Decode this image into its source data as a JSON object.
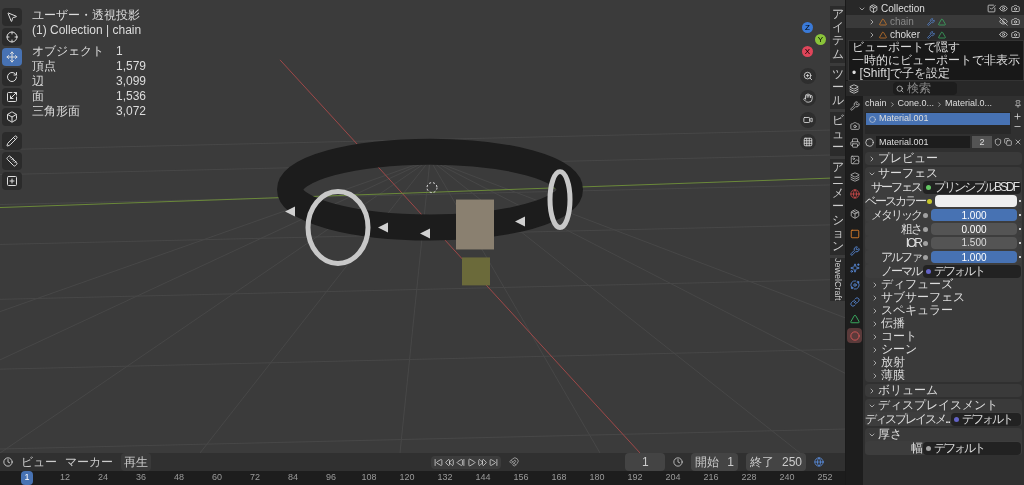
{
  "viewport": {
    "view_name": "ユーザー・透視投影",
    "context": "(1) Collection | chain",
    "stats": [
      {
        "label": "オブジェクト",
        "value": "1"
      },
      {
        "label": "頂点",
        "value": "1,579"
      },
      {
        "label": "辺",
        "value": "3,099"
      },
      {
        "label": "面",
        "value": "1,536"
      },
      {
        "label": "三角形面",
        "value": "3,072"
      }
    ],
    "tools": [
      {
        "kind": "select",
        "selected": false
      },
      {
        "kind": "cursor",
        "selected": false
      },
      {
        "kind": "move",
        "selected": true
      },
      {
        "kind": "rotate",
        "selected": false
      },
      {
        "kind": "scale",
        "selected": false
      },
      {
        "kind": "transform",
        "selected": false
      },
      {
        "kind": "annotate",
        "selected": false
      },
      {
        "kind": "measure",
        "selected": false
      },
      {
        "kind": "add",
        "selected": false
      }
    ],
    "gizmo": {
      "x": "X",
      "y": "Y",
      "z": "Z"
    },
    "sidebar_tabs": [
      {
        "label": "アイテム",
        "kind": "cjk"
      },
      {
        "label": "ツール",
        "kind": "cjk"
      },
      {
        "label": "ビュー",
        "kind": "cjk"
      },
      {
        "label": "アニメーション",
        "kind": "cjk"
      },
      {
        "label": "JewelCraft",
        "kind": "latin"
      }
    ]
  },
  "outliner": {
    "collection": {
      "label": "Collection",
      "checked": true
    },
    "objects": [
      {
        "label": "chain",
        "selected": true,
        "hidden": true
      },
      {
        "label": "choker",
        "selected": false,
        "hidden": false
      }
    ],
    "tooltip": {
      "title": "ビューポートで隠す",
      "description": "一時的にビューポートで非表示",
      "hint": "• [Shift]で子を設定"
    }
  },
  "properties": {
    "search": {
      "placeholder": "検索"
    },
    "tabs": [
      {
        "kind": "tool",
        "selected": false
      },
      {
        "kind": "render",
        "selected": false
      },
      {
        "kind": "output",
        "selected": false
      },
      {
        "kind": "view_layer",
        "selected": false
      },
      {
        "kind": "scene",
        "selected": false
      },
      {
        "kind": "world",
        "selected": false
      },
      {
        "kind": "collection",
        "selected": false
      },
      {
        "kind": "object",
        "selected": false
      },
      {
        "kind": "modifier",
        "selected": false
      },
      {
        "kind": "particles",
        "selected": false
      },
      {
        "kind": "physics",
        "selected": false
      },
      {
        "kind": "constraints",
        "selected": false
      },
      {
        "kind": "data",
        "selected": false
      },
      {
        "kind": "material",
        "selected": true
      }
    ],
    "breadcrumb": [
      "chain",
      "Cone.0...",
      "Material.0..."
    ],
    "slots": [
      {
        "label": "Material.001",
        "selected": true
      }
    ],
    "material": {
      "name": "Material.001",
      "users": "2"
    },
    "panels": [
      {
        "title": "プレビュー",
        "expanded": false
      },
      {
        "title": "サーフェス",
        "expanded": true,
        "rows": [
          {
            "kind": "shader",
            "label": "サーフェス",
            "value": "プリンシプルBSDF",
            "color": "#63c763"
          },
          {
            "kind": "color",
            "label": "ベースカラー",
            "color": "#c7c729"
          },
          {
            "kind": "slider",
            "label": "メタリック",
            "value": "1.000",
            "level": 1,
            "color": "#a1a1a1"
          },
          {
            "kind": "slider",
            "label": "粗さ",
            "value": "0.000",
            "level": 0,
            "color": "#a1a1a1"
          },
          {
            "kind": "number",
            "label": "IOR",
            "value": "1.500",
            "color": "#a1a1a1"
          },
          {
            "kind": "slider",
            "label": "アルファ",
            "value": "1.000",
            "level": 1,
            "color": "#a1a1a1"
          },
          {
            "kind": "shader",
            "label": "ノーマル",
            "value": "デフォルト",
            "color": "#6363c7"
          }
        ],
        "subpanels": [
          "ディフューズ",
          "サブサーフェス",
          "スペキュラー",
          "伝播",
          "コート",
          "シーン",
          "放射",
          "薄膜"
        ]
      },
      {
        "title": "ボリューム",
        "expanded": false
      },
      {
        "title": "ディスプレイスメント",
        "expanded": true,
        "rows": [
          {
            "kind": "shader",
            "label": "ディスプレイスメ...",
            "value": "デフォルト",
            "color": "#6363c7"
          }
        ]
      },
      {
        "title": "厚さ",
        "expanded": true,
        "rows": [
          {
            "kind": "shader",
            "label": "幅",
            "value": "デフォルト",
            "color": "#a1a1a1"
          }
        ]
      }
    ]
  },
  "timeline": {
    "menus": [
      "ビュー",
      "マーカー"
    ],
    "playback": "再生",
    "current_frame": "1",
    "start_label": "開始",
    "start": "1",
    "end_label": "終了",
    "end": "250",
    "ticks": [
      {
        "label": "1",
        "selected": true
      },
      {
        "label": "12",
        "selected": false
      },
      {
        "label": "24",
        "selected": false
      },
      {
        "label": "36",
        "selected": false
      },
      {
        "label": "48",
        "selected": false
      },
      {
        "label": "60",
        "selected": false
      },
      {
        "label": "72",
        "selected": false
      },
      {
        "label": "84",
        "selected": false
      },
      {
        "label": "96",
        "selected": false
      },
      {
        "label": "108",
        "selected": false
      },
      {
        "label": "120",
        "selected": false
      },
      {
        "label": "132",
        "selected": false
      },
      {
        "label": "144",
        "selected": false
      },
      {
        "label": "156",
        "selected": false
      },
      {
        "label": "168",
        "selected": false
      },
      {
        "label": "180",
        "selected": false
      },
      {
        "label": "192",
        "selected": false
      },
      {
        "label": "204",
        "selected": false
      },
      {
        "label": "216",
        "selected": false
      },
      {
        "label": "228",
        "selected": false
      },
      {
        "label": "240",
        "selected": false
      },
      {
        "label": "252",
        "selected": false
      }
    ]
  }
}
